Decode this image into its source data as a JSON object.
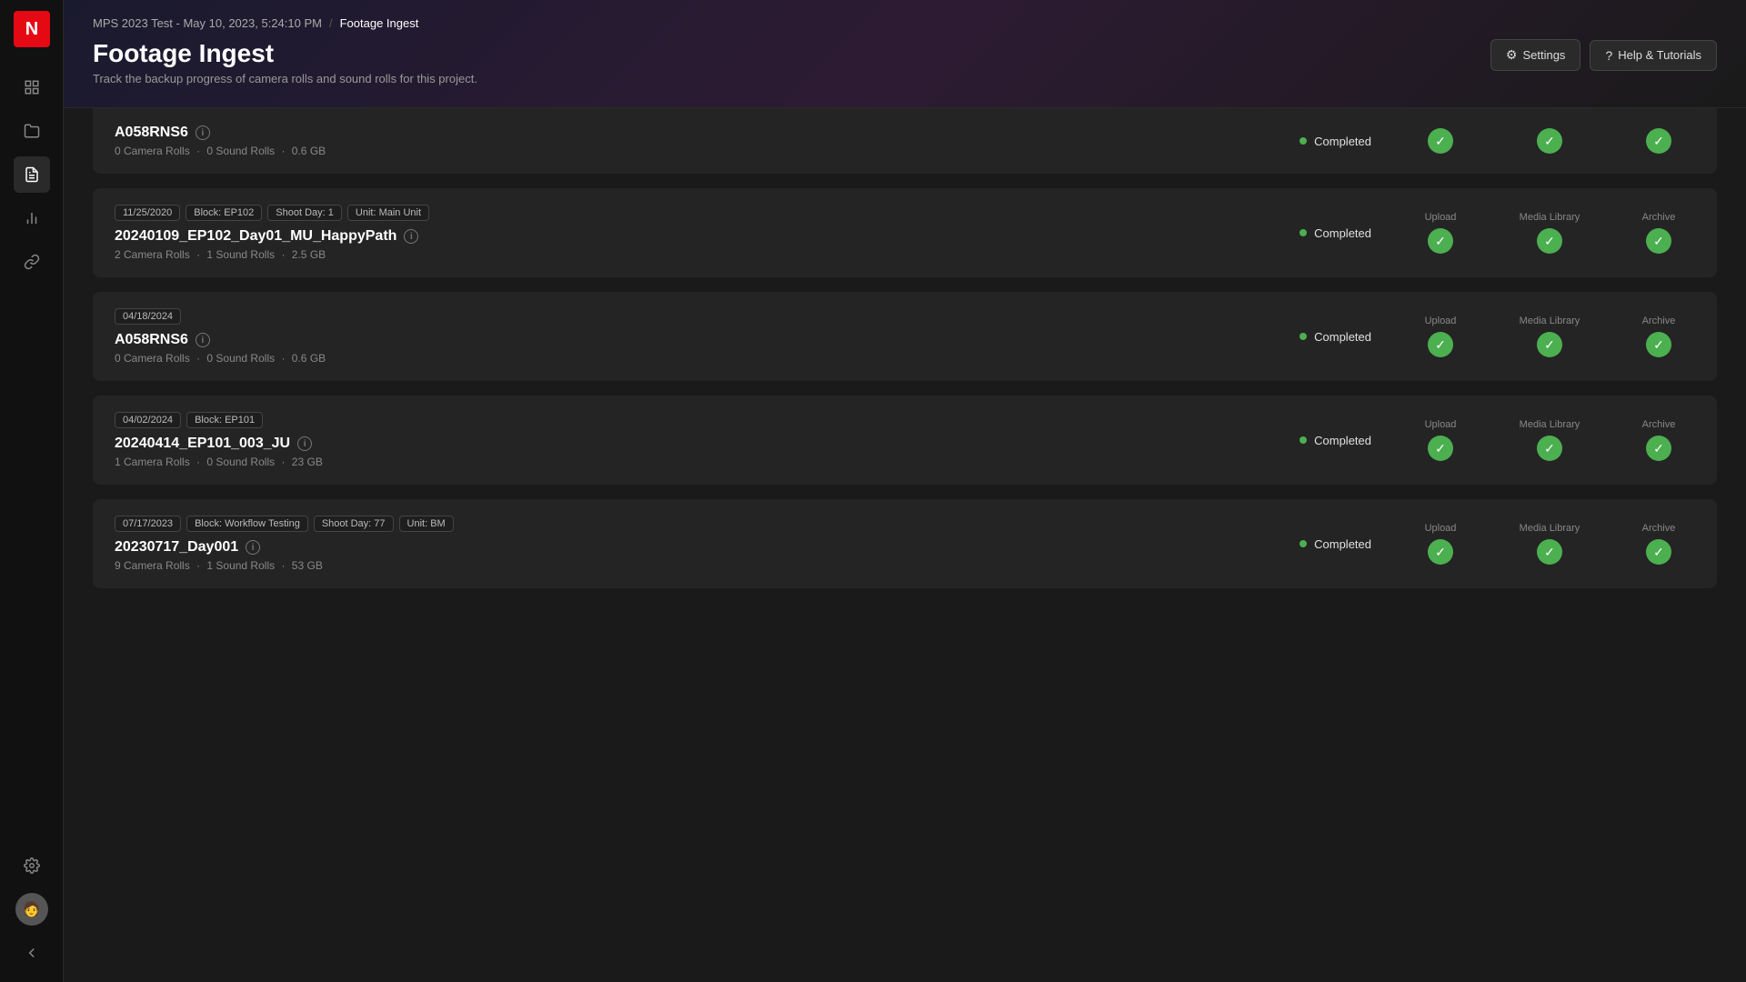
{
  "app": {
    "logo": "N"
  },
  "breadcrumb": {
    "parent": "MPS 2023 Test - May 10, 2023, 5:24:10 PM",
    "separator": "/",
    "current": "Footage Ingest"
  },
  "page": {
    "title": "Footage Ingest",
    "subtitle": "Track the backup progress of camera rolls and sound rolls for this project."
  },
  "buttons": {
    "settings": "Settings",
    "help": "Help & Tutorials"
  },
  "columns": {
    "upload": "Upload",
    "media_library": "Media Library",
    "archive": "Archive"
  },
  "cards": [
    {
      "id": "card-0-partial",
      "partial": true,
      "tags": [],
      "name": "A058RNS6",
      "show_info": true,
      "camera_rolls": 0,
      "sound_rolls": 0,
      "size": "0.6 GB",
      "status": "Completed",
      "upload_ok": true,
      "media_ok": true,
      "archive_ok": true
    },
    {
      "id": "card-1",
      "tags": [
        {
          "label": "11/25/2020"
        },
        {
          "label": "Block: EP102"
        },
        {
          "label": "Shoot Day: 1"
        },
        {
          "label": "Unit: Main Unit"
        }
      ],
      "name": "20240109_EP102_Day01_MU_HappyPath",
      "show_info": true,
      "camera_rolls": 2,
      "sound_rolls": 1,
      "size": "2.5 GB",
      "status": "Completed",
      "upload_ok": true,
      "media_ok": true,
      "archive_ok": true
    },
    {
      "id": "card-2",
      "tags": [
        {
          "label": "04/18/2024"
        }
      ],
      "name": "A058RNS6",
      "show_info": true,
      "camera_rolls": 0,
      "sound_rolls": 0,
      "size": "0.6 GB",
      "status": "Completed",
      "upload_ok": true,
      "media_ok": true,
      "archive_ok": true
    },
    {
      "id": "card-3",
      "tags": [
        {
          "label": "04/02/2024"
        },
        {
          "label": "Block: EP101"
        }
      ],
      "name": "20240414_EP101_003_JU",
      "show_info": true,
      "camera_rolls": 1,
      "sound_rolls": 0,
      "size": "23 GB",
      "status": "Completed",
      "upload_ok": true,
      "media_ok": true,
      "archive_ok": true
    },
    {
      "id": "card-4",
      "tags": [
        {
          "label": "07/17/2023"
        },
        {
          "label": "Block: Workflow Testing"
        },
        {
          "label": "Shoot Day: 77"
        },
        {
          "label": "Unit: BM"
        }
      ],
      "name": "20230717_Day001",
      "show_info": true,
      "camera_rolls": 9,
      "sound_rolls": 1,
      "size": "53 GB",
      "status": "Completed",
      "upload_ok": true,
      "media_ok": true,
      "archive_ok": true
    }
  ],
  "sidebar": {
    "items": [
      {
        "icon": "▦",
        "name": "dashboard",
        "active": false
      },
      {
        "icon": "📁",
        "name": "folder",
        "active": false
      },
      {
        "icon": "📋",
        "name": "list",
        "active": true
      },
      {
        "icon": "📊",
        "name": "chart",
        "active": false
      },
      {
        "icon": "🔗",
        "name": "chain",
        "active": false
      }
    ],
    "bottom": [
      {
        "icon": "⚙",
        "name": "settings"
      },
      {
        "icon": "◐",
        "name": "collapse"
      }
    ]
  }
}
